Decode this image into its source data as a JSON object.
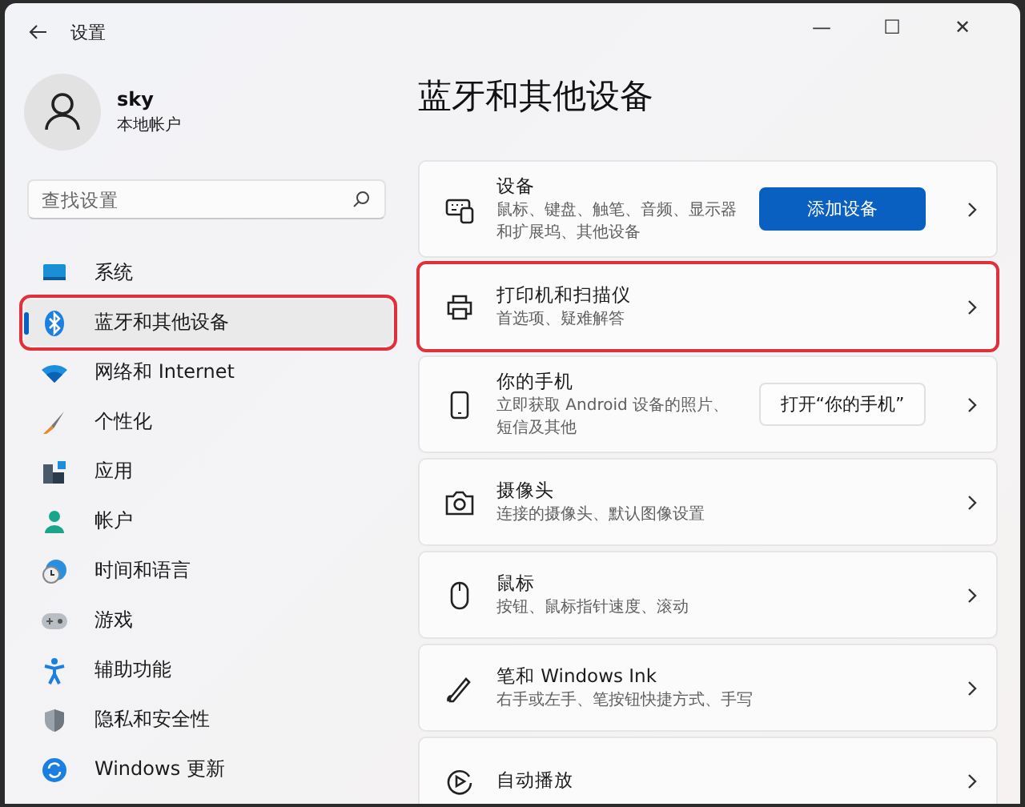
{
  "window": {
    "title": "设置",
    "controls": [
      "—",
      "☐",
      "✕"
    ]
  },
  "user": {
    "name": "sky",
    "account": "本地帐户"
  },
  "search": {
    "placeholder": "查找设置"
  },
  "nav": {
    "items": [
      {
        "label": "系统",
        "selected": false,
        "highlighted": false
      },
      {
        "label": "蓝牙和其他设备",
        "selected": true,
        "highlighted": true
      },
      {
        "label": "网络和 Internet",
        "selected": false,
        "highlighted": false
      },
      {
        "label": "个性化",
        "selected": false,
        "highlighted": false
      },
      {
        "label": "应用",
        "selected": false,
        "highlighted": false
      },
      {
        "label": "帐户",
        "selected": false,
        "highlighted": false
      },
      {
        "label": "时间和语言",
        "selected": false,
        "highlighted": false
      },
      {
        "label": "游戏",
        "selected": false,
        "highlighted": false
      },
      {
        "label": "辅助功能",
        "selected": false,
        "highlighted": false
      },
      {
        "label": "隐私和安全性",
        "selected": false,
        "highlighted": false
      },
      {
        "label": "Windows 更新",
        "selected": false,
        "highlighted": false
      }
    ]
  },
  "page_title": "蓝牙和其他设备",
  "cards": [
    {
      "title": "设备",
      "subtitle": "鼠标、键盘、触笔、音频、显示器和扩展坞、其他设备",
      "button": {
        "label": "添加设备",
        "kind": "primary"
      },
      "highlighted": false
    },
    {
      "title": "打印机和扫描仪",
      "subtitle": "首选项、疑难解答",
      "highlighted": true
    },
    {
      "title": "你的手机",
      "subtitle": "立即获取 Android 设备的照片、短信及其他",
      "button": {
        "label": "打开“你的手机”",
        "kind": "secondary"
      },
      "highlighted": false
    },
    {
      "title": "摄像头",
      "subtitle": "连接的摄像头、默认图像设置",
      "highlighted": false
    },
    {
      "title": "鼠标",
      "subtitle": "按钮、鼠标指针速度、滚动",
      "highlighted": false
    },
    {
      "title": "笔和 Windows Ink",
      "subtitle": "右手或左手、笔按钮快捷方式、手写",
      "highlighted": false
    },
    {
      "title": "自动播放",
      "highlighted": false
    }
  ]
}
